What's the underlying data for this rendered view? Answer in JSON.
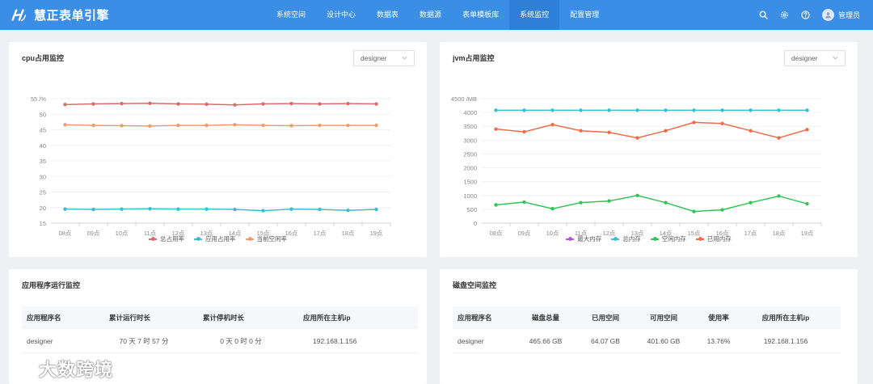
{
  "app": {
    "title": "慧正表单引擎",
    "nav": [
      {
        "label": "系统空间",
        "active": false
      },
      {
        "label": "设计中心",
        "active": false
      },
      {
        "label": "数据表",
        "active": false
      },
      {
        "label": "数据源",
        "active": false
      },
      {
        "label": "表单模板库",
        "active": false
      },
      {
        "label": "系统监控",
        "active": true
      },
      {
        "label": "配置管理",
        "active": false
      }
    ],
    "user_name": "管理员"
  },
  "cpu_panel": {
    "title": "cpu占用监控",
    "select_value": "designer",
    "chart_data": {
      "type": "line",
      "ylabel": "55 /%",
      "ylim": [
        15,
        55
      ],
      "yticks": [
        55,
        50,
        45,
        40,
        35,
        30,
        25,
        20,
        15
      ],
      "ytick_labels": [
        "55 /%",
        "50",
        "45",
        "40",
        "35",
        "30",
        "25",
        "20",
        "15"
      ],
      "categories": [
        "08点",
        "09点",
        "10点",
        "11点",
        "12点",
        "13点",
        "14点",
        "15点",
        "16点",
        "17点",
        "18点",
        "19点"
      ],
      "series": [
        {
          "name": "总占用率",
          "color": "#d86c6c",
          "values": [
            53.1,
            53.3,
            53.4,
            53.5,
            53.3,
            53.2,
            53.0,
            53.3,
            53.4,
            53.3,
            53.4,
            53.3
          ]
        },
        {
          "name": "应用占用率",
          "color": "#3dbdd0",
          "values": [
            19.5,
            19.4,
            19.5,
            19.6,
            19.5,
            19.5,
            19.4,
            19.0,
            19.5,
            19.4,
            19.1,
            19.4
          ]
        },
        {
          "name": "当前空闲率",
          "color": "#f29c6b",
          "values": [
            46.6,
            46.4,
            46.3,
            46.2,
            46.4,
            46.4,
            46.6,
            46.4,
            46.3,
            46.4,
            46.4,
            46.4
          ]
        }
      ],
      "legend": "bottom"
    }
  },
  "jvm_panel": {
    "title": "jvm占用监控",
    "select_value": "designer",
    "chart_data": {
      "type": "line",
      "ylabel": "4500 /MB",
      "ylim": [
        0,
        4500
      ],
      "yticks": [
        4500,
        4000,
        3500,
        3000,
        2500,
        2000,
        1500,
        1000,
        500,
        0
      ],
      "ytick_labels": [
        "4500 /MB",
        "4000",
        "3500",
        "3000",
        "2500",
        "2000",
        "1500",
        "1000",
        "500",
        "0"
      ],
      "categories": [
        "08点",
        "09点",
        "10点",
        "11点",
        "12点",
        "13点",
        "14点",
        "15点",
        "16点",
        "17点",
        "18点",
        "19点"
      ],
      "series": [
        {
          "name": "最大内存",
          "color": "#b05cc4",
          "values": []
        },
        {
          "name": "总内存",
          "color": "#3dbdd0",
          "values": [
            4080,
            4080,
            4080,
            4080,
            4080,
            4080,
            4080,
            4080,
            4080,
            4080,
            4080,
            4080
          ]
        },
        {
          "name": "空闲内存",
          "color": "#35c45a",
          "values": [
            660,
            760,
            520,
            740,
            800,
            1000,
            740,
            420,
            480,
            740,
            980,
            700
          ]
        },
        {
          "name": "已用内存",
          "color": "#ef6d4a",
          "values": [
            3400,
            3300,
            3560,
            3340,
            3280,
            3080,
            3340,
            3640,
            3600,
            3340,
            3080,
            3380
          ]
        }
      ],
      "legend": "bottom"
    }
  },
  "app_panel": {
    "title": "应用程序运行监控",
    "columns": [
      "应用程序名",
      "累计运行时长",
      "累计停机时长",
      "应用所在主机ip"
    ],
    "rows": [
      [
        "designer",
        "70 天 7 时 57 分",
        "0 天 0 时 0 分",
        "192.168.1.156"
      ]
    ]
  },
  "disk_panel": {
    "title": "磁盘空间监控",
    "columns": [
      "应用程序名",
      "磁盘总量",
      "已用空间",
      "可用空间",
      "使用率",
      "应用所在主机ip"
    ],
    "rows": [
      [
        "designer",
        "465.66 GB",
        "64.07 GB",
        "401.60 GB",
        "13.76%",
        "192.168.1.156"
      ]
    ]
  },
  "watermark_text": "大数跨境"
}
